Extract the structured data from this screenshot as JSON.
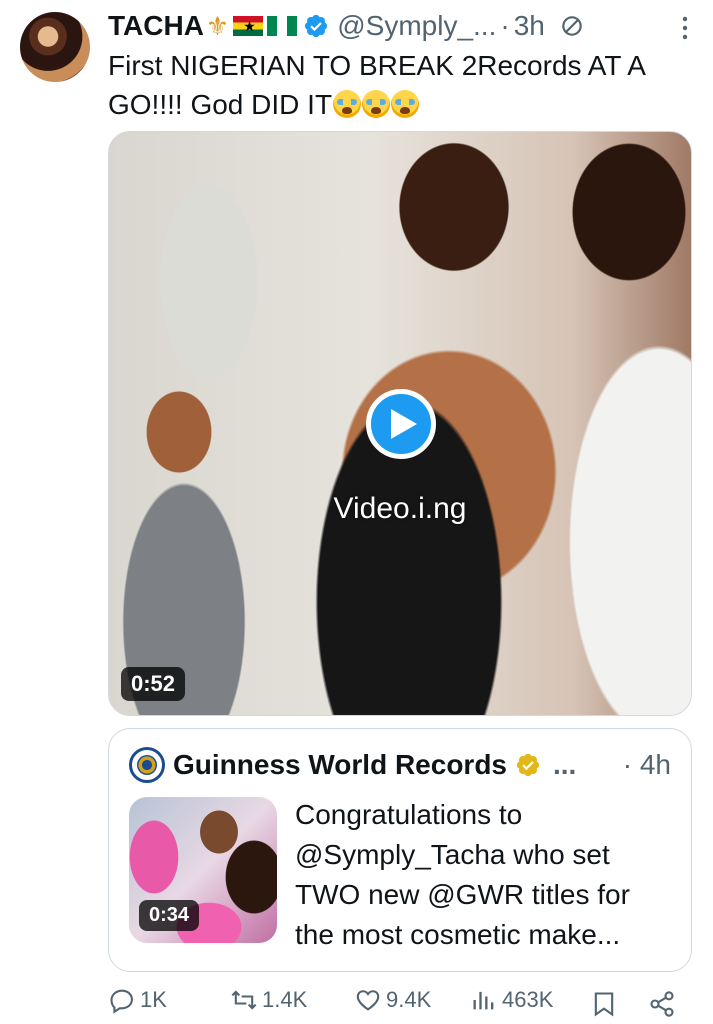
{
  "tweet": {
    "author_name": "TACHA",
    "author_handle": "@Symply_...",
    "separator": "·",
    "time": "3h",
    "text": "First NIGERIAN TO BREAK 2Records AT A GO!!!! God DID IT",
    "emoji_count": 3
  },
  "media": {
    "watermark": "Video.i.ng",
    "duration": "0:52"
  },
  "quote": {
    "author_name": "Guinness World Records",
    "ellipsis": "...",
    "separator": "·",
    "time": "4h",
    "text": "Congratulations to @Symply_Tacha who set TWO new @GWR titles for the most cosmetic make...",
    "thumb_duration": "0:34"
  },
  "actions": {
    "replies": "1K",
    "reposts": "1.4K",
    "likes": "9.4K",
    "views": "463K"
  },
  "colors": {
    "accent": "#1d9bf0",
    "text": "#0f1419",
    "secondary": "#536471",
    "border": "#cfd9de",
    "gold": "#e2b719"
  },
  "icons": [
    "trident-icon",
    "ghana-flag-icon",
    "nigeria-flag-icon",
    "verified-icon",
    "muted-icon",
    "more-icon",
    "play-icon",
    "gold-verified-icon",
    "reply-icon",
    "repost-icon",
    "like-icon",
    "views-icon",
    "bookmark-icon",
    "share-icon"
  ]
}
